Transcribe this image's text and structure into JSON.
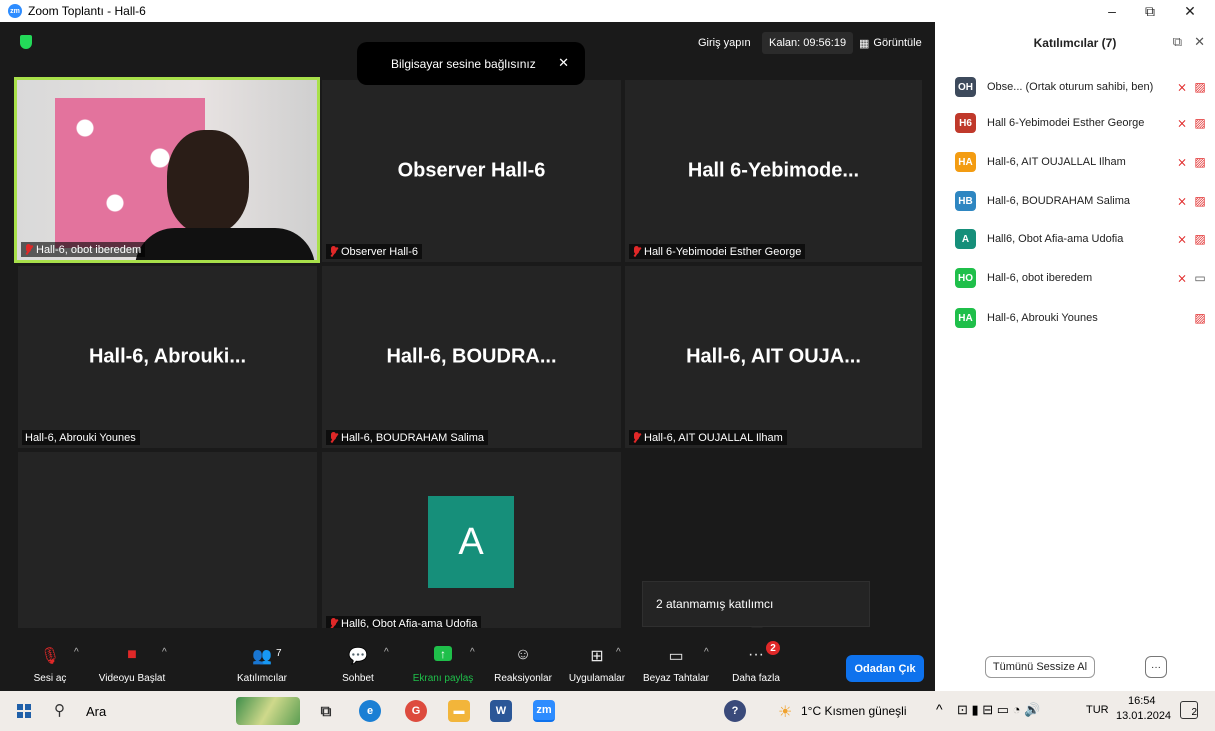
{
  "window": {
    "title": "Zoom Toplantı - Hall-6",
    "app_logo": "zm",
    "controls": {
      "minimize": "–",
      "restore": "⧉",
      "close": "✕"
    }
  },
  "meeting": {
    "top_bar": {
      "signin_label": "Giriş yapın",
      "remaining_label": "Kalan: 09:56:19",
      "view_label": "Görüntüle"
    },
    "toast": {
      "message": "Bilgisayar sesine bağlısınız",
      "close": "✕"
    },
    "tiles": [
      {
        "label": "Hall-6, obot iberedem",
        "type": "video"
      },
      {
        "display": "Observer Hall-6",
        "label": "Observer Hall-6"
      },
      {
        "display": "Hall 6-Yebimode...",
        "label": "Hall 6-Yebimodei Esther George"
      },
      {
        "display": "Hall-6, Abrouki...",
        "label": "Hall-6, Abrouki Younes"
      },
      {
        "display": "Hall-6, BOUDRA...",
        "label": "Hall-6, BOUDRAHAM Salima"
      },
      {
        "display": "Hall-6, AIT OUJA...",
        "label": "Hall-6, AIT OUJALLAL Ilham"
      },
      {
        "avatar_letter": "A",
        "label": "Hall6, Obot Afia-ama Udofia",
        "avatar_color": "#168f7a"
      }
    ],
    "unassigned_popup": "2 atanmamış katılımcı"
  },
  "toolbar": {
    "unmute": "Sesi aç",
    "start_video": "Videoyu Başlat",
    "participants": "Katılımcılar",
    "participants_count": "7",
    "chat": "Sohbet",
    "share_screen": "Ekranı paylaş",
    "reactions": "Reaksiyonlar",
    "apps": "Uygulamalar",
    "whiteboards": "Beyaz Tahtalar",
    "more": "Daha fazla",
    "more_badge": "2",
    "leave": "Odadan Çık"
  },
  "panel": {
    "title": "Katılımcılar (7)",
    "participants": [
      {
        "initials": "OH",
        "name": "Obse... (Ortak oturum sahibi, ben)",
        "color": "#3d4a5c",
        "mic": "muted",
        "camera": "off"
      },
      {
        "initials": "H6",
        "name": "Hall 6-Yebimodei  Esther George",
        "color": "#c0392b",
        "mic": "muted",
        "camera": "off"
      },
      {
        "initials": "HA",
        "name": "Hall-6, AIT OUJALLAL Ilham",
        "color": "#f39c12",
        "mic": "muted",
        "camera": "off"
      },
      {
        "initials": "HB",
        "name": "Hall-6, BOUDRAHAM Salima",
        "color": "#2e86c1",
        "mic": "muted",
        "camera": "off"
      },
      {
        "initials": "A",
        "name": "Hall6, Obot Afia-ama Udofia",
        "color": "#168f7a",
        "mic": "muted",
        "camera": "off"
      },
      {
        "initials": "HO",
        "name": "Hall-6, obot iberedem",
        "color": "#1fbf4a",
        "mic": "muted",
        "camera": "on"
      },
      {
        "initials": "HA",
        "name": "Hall-6, Abrouki Younes",
        "color": "#1fbf4a",
        "mic": "none",
        "camera": "off"
      }
    ],
    "mute_all": "Tümünü Sessize Al",
    "more": "···"
  },
  "taskbar": {
    "search": "Ara",
    "weather": "1°C  Kısmen güneşli",
    "language": "TUR",
    "time": "16:54",
    "date": "13.01.2024",
    "notification_count": "2"
  }
}
